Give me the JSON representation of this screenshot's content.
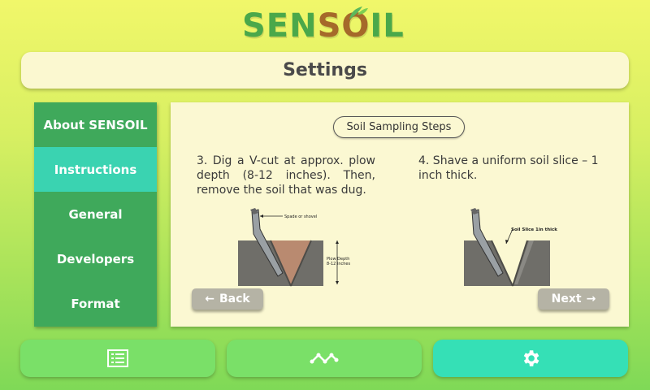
{
  "logo": {
    "part1": "SEN",
    "part2": "SO",
    "part3": "IL"
  },
  "header": {
    "title": "Settings"
  },
  "sidebar": {
    "items": [
      {
        "label": "About SENSOIL",
        "active": false
      },
      {
        "label": "Instructions",
        "active": true
      },
      {
        "label": "General",
        "active": false
      },
      {
        "label": "Developers",
        "active": false
      },
      {
        "label": "Format",
        "active": false
      }
    ]
  },
  "panel": {
    "section_title": "Soil Sampling Steps",
    "step3": {
      "text": "3. Dig a V-cut at approx. plow depth (8-12 inches). Then, remove the soil that was dug.",
      "label_spade": "Spade or shovel",
      "label_depth_1": "Plow Depth",
      "label_depth_2": "8-12 inches"
    },
    "step4": {
      "text": "4. Shave a uniform soil slice – 1 inch thick.",
      "label_slice": "Soil Slice 1in thick"
    },
    "back_label": "Back",
    "next_label": "Next",
    "back_icon": "arrow-left-icon",
    "next_icon": "arrow-right-icon"
  },
  "bottom_nav": {
    "items": [
      {
        "icon": "list-icon",
        "active": false
      },
      {
        "icon": "chart-line-icon",
        "active": false
      },
      {
        "icon": "gear-icon",
        "active": true
      }
    ]
  },
  "colors": {
    "sidebar": "#3fa95b",
    "sidebar_active": "#3ad3b1",
    "bottom_button": "#7ae068",
    "bottom_active": "#35e0b6",
    "panel_bg": "#fbf8d2"
  }
}
